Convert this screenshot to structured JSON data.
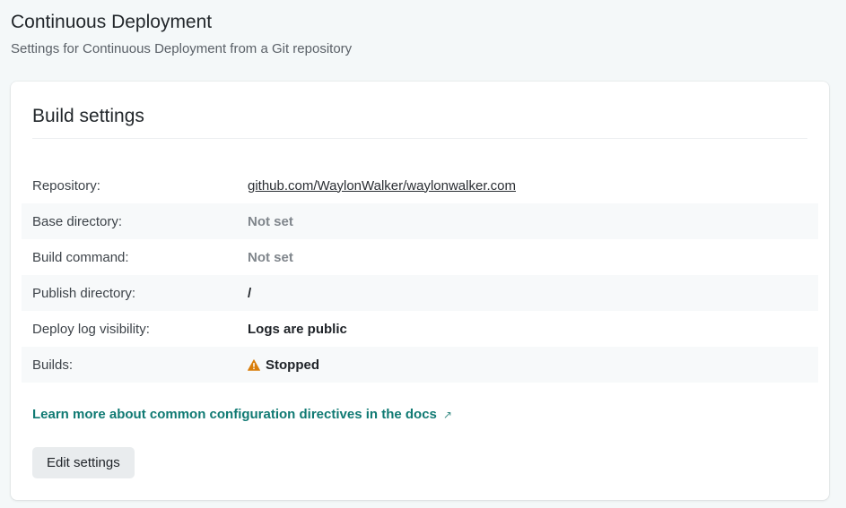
{
  "header": {
    "title": "Continuous Deployment",
    "subtitle": "Settings for Continuous Deployment from a Git repository"
  },
  "card": {
    "title": "Build settings",
    "rows": [
      {
        "label": "Repository:",
        "value": "github.com/WaylonWalker/waylonwalker.com"
      },
      {
        "label": "Base directory:",
        "value": "Not set"
      },
      {
        "label": "Build command:",
        "value": "Not set"
      },
      {
        "label": "Publish directory:",
        "value": "/"
      },
      {
        "label": "Deploy log visibility:",
        "value": "Logs are public"
      },
      {
        "label": "Builds:",
        "value": "Stopped",
        "icon": "warning-icon"
      }
    ],
    "docs_link": "Learn more about common configuration directives in the docs",
    "docs_link_icon": "external-link-icon",
    "edit_button": "Edit settings"
  },
  "colors": {
    "accent_link": "#107a73",
    "warning": "#d97e0b",
    "background": "#f4f8f9"
  }
}
